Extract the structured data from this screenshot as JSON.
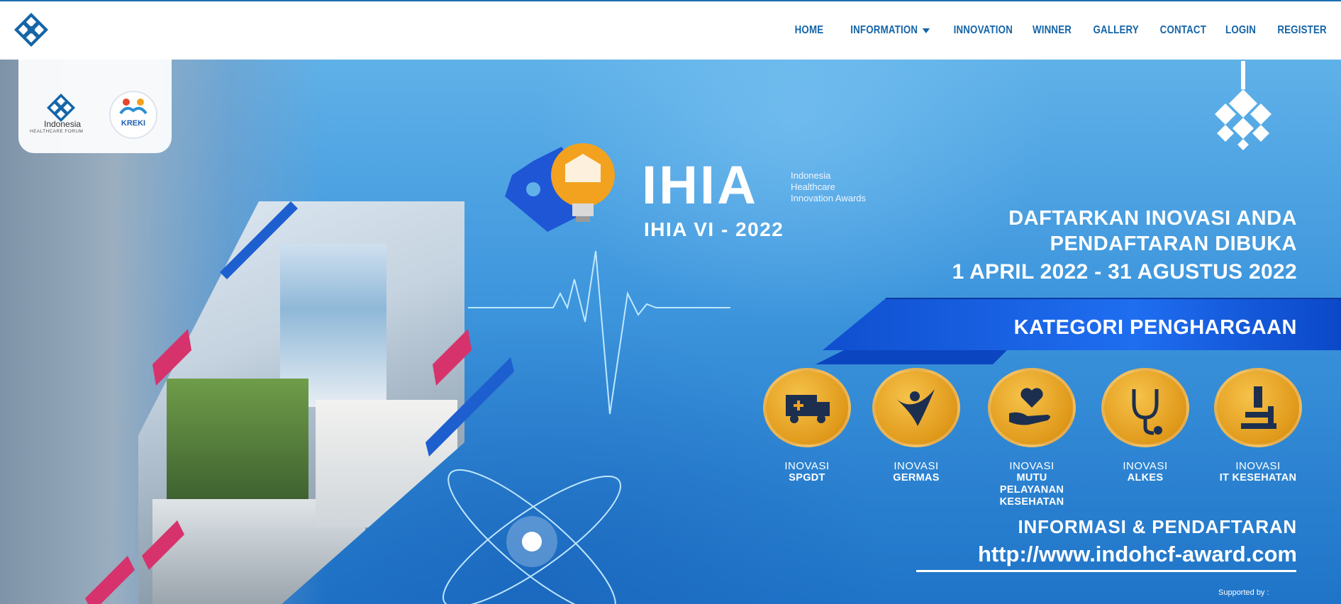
{
  "nav": {
    "items": [
      {
        "label": "HOME"
      },
      {
        "label": "INFORMATION"
      },
      {
        "label": "INNOVATION"
      },
      {
        "label": "WINNER"
      },
      {
        "label": "GALLERY"
      },
      {
        "label": "CONTACT"
      },
      {
        "label": "LOGIN"
      },
      {
        "label": "REGISTER"
      }
    ]
  },
  "banner": {
    "logo_card": {
      "forum_name": "Indonesia",
      "forum_sub": "HEALTHCARE FORUM",
      "partner": "KREKI"
    },
    "ihia": {
      "title": "IHIA",
      "full_name": "Indonesia Healthcare Innovation Awards",
      "edition": "IHIA VI - 2022"
    },
    "headline": {
      "line1": "DAFTARKAN INOVASI ANDA",
      "line2": "PENDAFTARAN DIBUKA",
      "dates": "1 APRIL 2022 - 31 AGUSTUS 2022"
    },
    "category_title": "KATEGORI PENGHARGAAN",
    "categories": [
      {
        "top": "INOVASI",
        "name": "SPGDT",
        "icon": "ambulance-icon"
      },
      {
        "top": "INOVASI",
        "name": "GERMAS",
        "icon": "figure-icon"
      },
      {
        "top": "INOVASI",
        "name": "MUTU PELAYANAN KESEHATAN",
        "icon": "heart-hand-icon"
      },
      {
        "top": "INOVASI",
        "name": "ALKES",
        "icon": "stethoscope-icon"
      },
      {
        "top": "INOVASI",
        "name": "IT KESEHATAN",
        "icon": "microscope-icon"
      }
    ],
    "info_label": "INFORMASI & PENDAFTARAN",
    "url": "http://www.indohcf-award.com",
    "supported": "Supported by :"
  },
  "colors": {
    "nav_text": "#1565a8",
    "accent_gold": "#e0991a",
    "banner_blue": "#3d95dc"
  }
}
